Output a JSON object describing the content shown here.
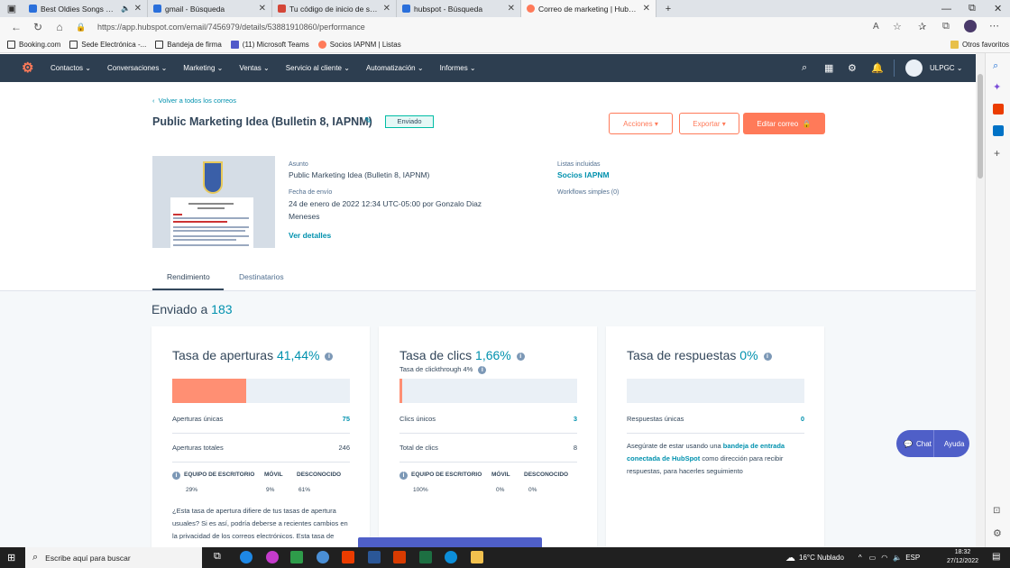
{
  "browser": {
    "tabs": [
      {
        "label": "Best Oldies Songs Of 1980s",
        "icon_color": "#ff0000"
      },
      {
        "label": "gmail - Búsqueda",
        "icon_color": "#2a6fdb"
      },
      {
        "label": "Tu código de inicio de sesión de",
        "icon_color": "#d44638"
      },
      {
        "label": "hubspot - Búsqueda",
        "icon_color": "#2a6fdb"
      },
      {
        "label": "Correo de marketing | HubSpot",
        "icon_color": "#ff7a59"
      }
    ],
    "url": "https://app.hubspot.com/email/7456979/details/53881910860/performance",
    "bookmarks": [
      "Booking.com",
      "Sede Electrónica -...",
      "Bandeja de firma",
      "(11) Microsoft Teams",
      "Socios IAPNM | Listas"
    ],
    "other_favorites": "Otros favoritos"
  },
  "hubspot_nav": {
    "items": [
      "Contactos",
      "Conversaciones",
      "Marketing",
      "Ventas",
      "Servicio al cliente",
      "Automatización",
      "Informes"
    ],
    "account": "ULPGC"
  },
  "email": {
    "back_link": "Volver a todos los correos",
    "title": "Public Marketing Idea (Bulletin 8, IAPNM)",
    "status": "Enviado",
    "actions_label": "Acciones",
    "export_label": "Exportar",
    "edit_label": "Editar correo",
    "subject_label": "Asunto",
    "subject": "Public Marketing Idea (Bulletin 8, IAPNM)",
    "date_label": "Fecha de envío",
    "date_line1": "24 de enero de 2022 12:34 UTC-05:00 por Gonzalo Diaz",
    "date_line2": "Meneses",
    "details_link": "Ver detalles",
    "lists_label": "Listas incluidas",
    "list_name": "Socios IAPNM",
    "workflows": "Workflows simples (0)"
  },
  "tabs": {
    "performance": "Rendimiento",
    "recipients": "Destinatarios"
  },
  "sent": {
    "label": "Enviado a",
    "count": "183"
  },
  "opens": {
    "title": "Tasa de aperturas",
    "rate": "41,44%",
    "fill": 0.4144,
    "unique_label": "Aperturas únicas",
    "unique": "75",
    "total_label": "Aperturas totales",
    "total": "246",
    "devices": [
      "EQUIPO DE ESCRITORIO",
      "MÓVIL",
      "DESCONOCIDO"
    ],
    "device_values": [
      "29%",
      "9%",
      "61%"
    ],
    "note": "¿Esta tasa de apertura difiere de tus tasas de apertura usuales? Si es así, podría deberse a recientes cambios en la privacidad de los correos electrónicos. Esta tasa de apertura incluye correos"
  },
  "clicks": {
    "title": "Tasa de clics",
    "rate": "1,66%",
    "fill": 0.0166,
    "ctr": "Tasa de clickthrough 4%",
    "unique_label": "Clics únicos",
    "unique": "3",
    "total_label": "Total de clics",
    "total": "8",
    "devices": [
      "EQUIPO DE ESCRITORIO",
      "MÓVIL",
      "DESCONOCIDO"
    ],
    "device_values": [
      "100%",
      "0%",
      "0%"
    ]
  },
  "replies": {
    "title": "Tasa de respuestas",
    "rate": "0%",
    "fill": 0,
    "unique_label": "Respuestas únicas",
    "unique": "0",
    "note_pre": "Asegúrate de estar usando una ",
    "note_link": "bandeja de entrada conectada de HubSpot",
    "note_post": " como dirección para recibir respuestas, para hacerles seguimiento"
  },
  "chat": {
    "chat": "Chat",
    "help": "Ayuda"
  },
  "taskbar": {
    "search": "Escribe aquí para buscar",
    "weather": "16°C  Nublado",
    "time": "18:32",
    "date": "27/12/2022"
  }
}
